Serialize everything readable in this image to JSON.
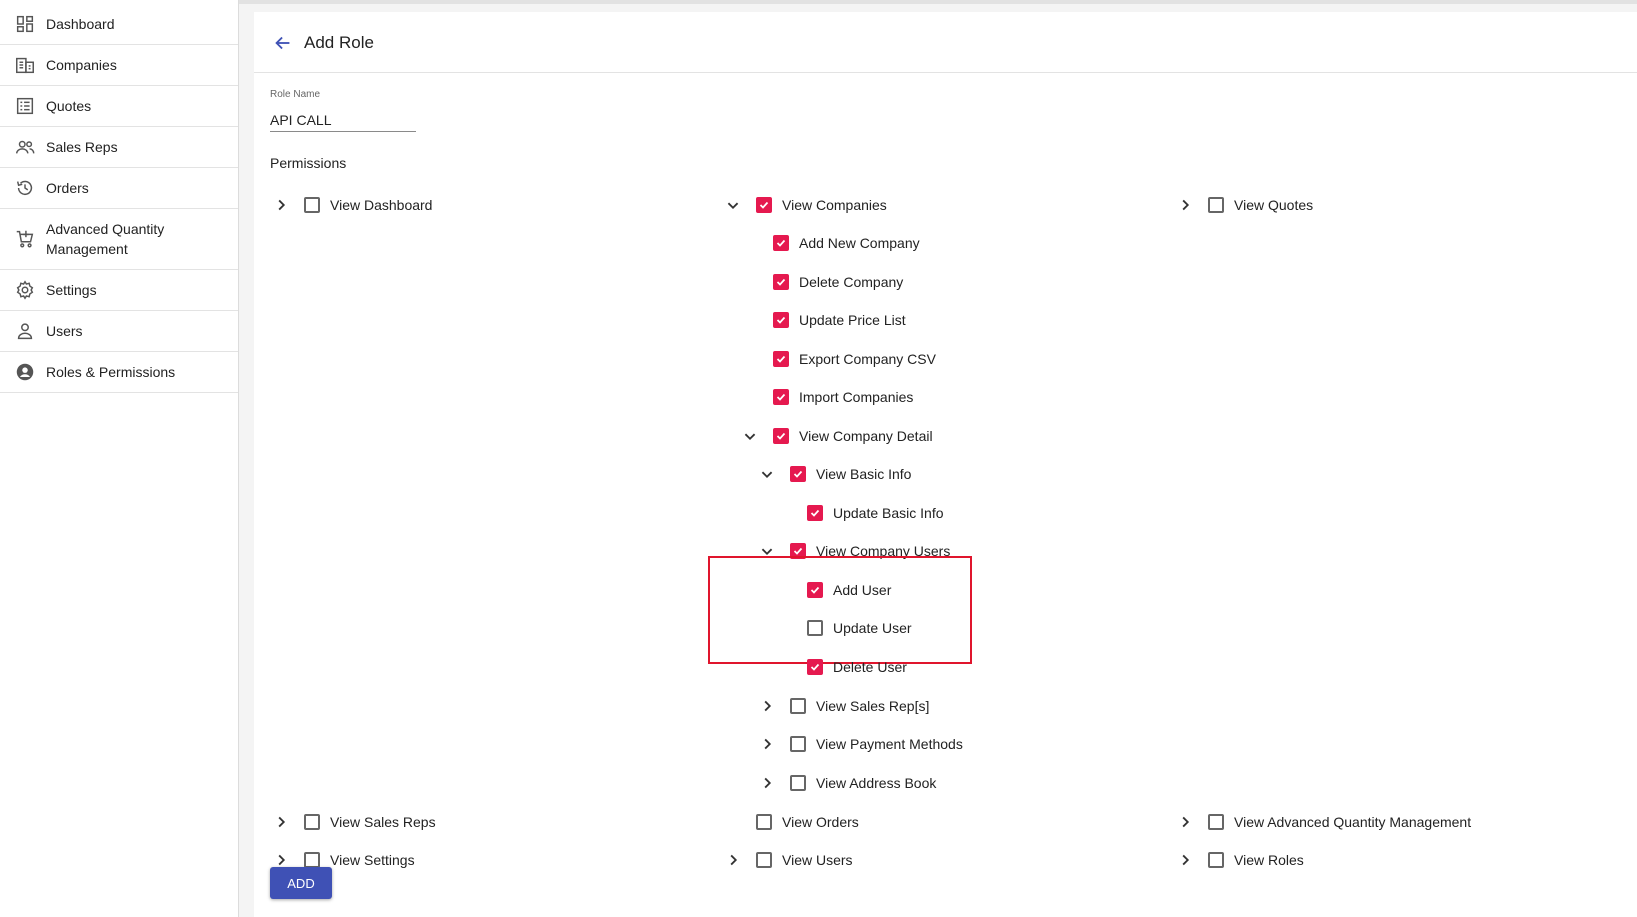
{
  "sidebar": {
    "items": [
      {
        "label": "Dashboard",
        "icon": "dashboard-icon"
      },
      {
        "label": "Companies",
        "icon": "building-icon"
      },
      {
        "label": "Quotes",
        "icon": "list-icon"
      },
      {
        "label": "Sales Reps",
        "icon": "people-icon"
      },
      {
        "label": "Orders",
        "icon": "history-icon"
      },
      {
        "label": "Advanced Quantity Management",
        "icon": "cart-icon"
      },
      {
        "label": "Settings",
        "icon": "gear-icon"
      },
      {
        "label": "Users",
        "icon": "person-icon"
      },
      {
        "label": "Roles & Permissions",
        "icon": "account-circle-icon"
      }
    ]
  },
  "header": {
    "title": "Add Role",
    "back_icon": "arrow-left-icon"
  },
  "role_name": {
    "label": "Role Name",
    "value": "API CALL"
  },
  "permissions": {
    "heading": "Permissions",
    "view_dashboard": {
      "label": "View Dashboard",
      "checked": false,
      "expandable": true,
      "expanded": false
    },
    "view_companies": {
      "label": "View Companies",
      "checked": true,
      "expandable": true,
      "expanded": true
    },
    "add_new_company": {
      "label": "Add New Company",
      "checked": true
    },
    "delete_company": {
      "label": "Delete Company",
      "checked": true
    },
    "update_price_list": {
      "label": "Update Price List",
      "checked": true
    },
    "export_company_csv": {
      "label": "Export Company CSV",
      "checked": true
    },
    "import_companies": {
      "label": "Import Companies",
      "checked": true
    },
    "view_company_detail": {
      "label": "View Company Detail",
      "checked": true,
      "expandable": true,
      "expanded": true
    },
    "view_basic_info": {
      "label": "View Basic Info",
      "checked": true,
      "expandable": true,
      "expanded": true
    },
    "update_basic_info": {
      "label": "Update Basic Info",
      "checked": true
    },
    "view_company_users": {
      "label": "View Company Users",
      "checked": true,
      "expandable": true,
      "expanded": true
    },
    "add_user": {
      "label": "Add User",
      "checked": true
    },
    "update_user": {
      "label": "Update User",
      "checked": false
    },
    "delete_user": {
      "label": "Delete User",
      "checked": true
    },
    "view_sales_rep_s": {
      "label": "View Sales Rep[s]",
      "checked": false,
      "expandable": true,
      "expanded": false
    },
    "view_payment_methods": {
      "label": "View Payment Methods",
      "checked": false,
      "expandable": true,
      "expanded": false
    },
    "view_address_book": {
      "label": "View Address Book",
      "checked": false,
      "expandable": true,
      "expanded": false
    },
    "view_quotes": {
      "label": "View Quotes",
      "checked": false,
      "expandable": true,
      "expanded": false
    },
    "view_sales_reps": {
      "label": "View Sales Reps",
      "checked": false,
      "expandable": true,
      "expanded": false
    },
    "view_orders": {
      "label": "View Orders",
      "checked": false,
      "expandable": false
    },
    "view_advanced_quantity_management": {
      "label": "View Advanced Quantity Management",
      "checked": false,
      "expandable": true,
      "expanded": false
    },
    "view_settings": {
      "label": "View Settings",
      "checked": false,
      "expandable": true,
      "expanded": false
    },
    "view_users": {
      "label": "View Users",
      "checked": false,
      "expandable": true,
      "expanded": false
    },
    "view_roles": {
      "label": "View Roles",
      "checked": false,
      "expandable": true,
      "expanded": false
    }
  },
  "actions": {
    "add_label": "ADD"
  },
  "colors": {
    "checkbox_checked": "#e5194f",
    "primary_button": "#3f51b5",
    "highlight_border": "#e0152d"
  }
}
